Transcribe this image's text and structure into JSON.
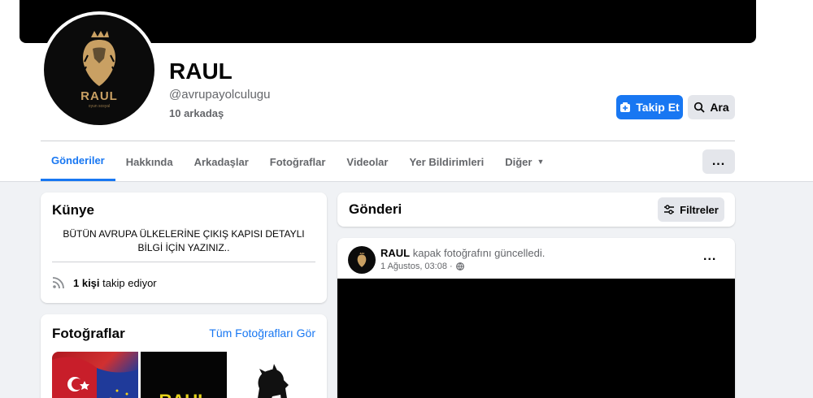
{
  "profile": {
    "name": "RAUL",
    "handle": "@avrupayolculugu",
    "friends": "10 arkadaş",
    "logo_text": "RAUL",
    "logo_subtext": "oyun sosyal"
  },
  "actions": {
    "follow_label": "Takip Et",
    "search_label": "Ara",
    "more_label": "..."
  },
  "tabs": [
    {
      "label": "Gönderiler",
      "active": true
    },
    {
      "label": "Hakkında"
    },
    {
      "label": "Arkadaşlar"
    },
    {
      "label": "Fotoğraflar"
    },
    {
      "label": "Videolar"
    },
    {
      "label": "Yer Bildirimleri"
    },
    {
      "label": "Diğer"
    }
  ],
  "intro": {
    "title": "Künye",
    "bio": "BÜTÜN AVRUPA ÜLKELERİNE ÇIKIŞ KAPISI DETAYLI BİLGİ İÇİN YAZINIZ..",
    "follow_count": "1 kişi",
    "follow_suffix": " takip ediyor"
  },
  "photos": {
    "title": "Fotoğraflar",
    "see_all": "Tüm Fotoğrafları Gör",
    "thumb2_text": "RAUL"
  },
  "posts": {
    "title": "Gönderi",
    "filters_label": "Filtreler",
    "author": "RAUL",
    "action_text": " kapak fotoğrafını güncelledi.",
    "time": "1 Ağustos, 03:08 ·"
  },
  "colors": {
    "accent": "#1877f2",
    "gold": "#c9a063",
    "background": "#f0f2f5"
  },
  "icons": {
    "follow": "follow-icon",
    "search": "search-icon",
    "caret": "caret-down-icon",
    "rss": "rss-icon",
    "filters": "sliders-icon",
    "globe": "globe-icon"
  }
}
